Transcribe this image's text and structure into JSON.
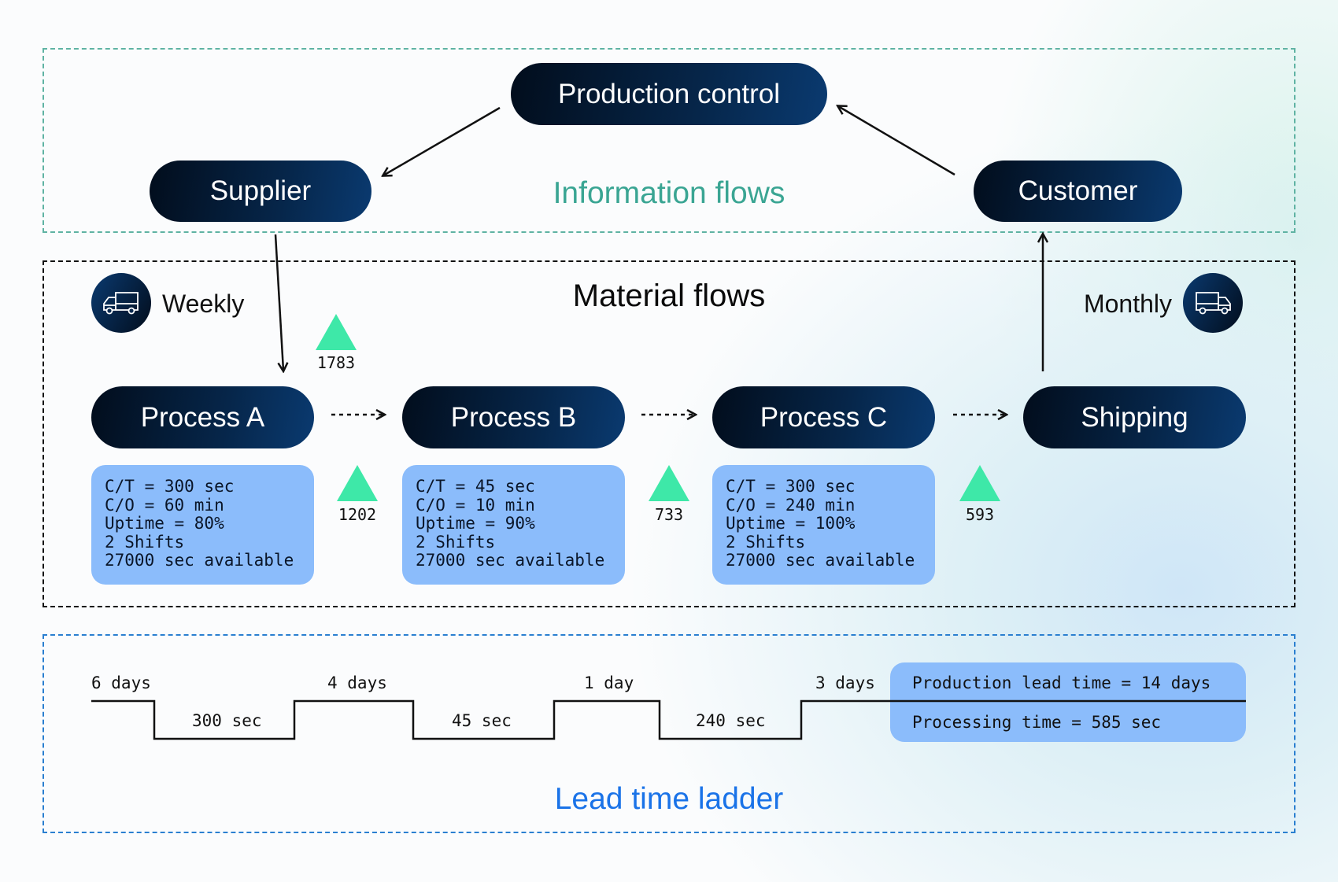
{
  "information_flows": {
    "title": "Information flows",
    "color": "#3aa593"
  },
  "material_flows": {
    "title": "Material flows"
  },
  "lead_time": {
    "title": "Lead time ladder",
    "color": "#1a73e8",
    "top_labels": [
      "6 days",
      "4 days",
      "1 day",
      "3 days"
    ],
    "bottom_labels": [
      "300 sec",
      "45 sec",
      "240 sec"
    ],
    "production_lead_time": "Production lead time = 14 days",
    "processing_time": "Processing time = 585 sec"
  },
  "nodes": {
    "production_control": "Production control",
    "supplier": "Supplier",
    "customer": "Customer"
  },
  "deliveries": {
    "supplier": {
      "label": "Weekly",
      "icon": "truck-icon"
    },
    "customer": {
      "label": "Monthly",
      "icon": "truck-icon"
    }
  },
  "processes": [
    {
      "name": "Process A",
      "details": "C/T = 300 sec\nC/O = 60 min\nUptime = 80%\n2 Shifts\n27000 sec available"
    },
    {
      "name": "Process B",
      "details": "C/T = 45 sec\nC/O = 10 min\nUptime = 90%\n2 Shifts\n27000 sec available"
    },
    {
      "name": "Process C",
      "details": "C/T = 300 sec\nC/O = 240 min\nUptime = 100%\n2 Shifts\n27000 sec available"
    },
    {
      "name": "Shipping"
    }
  ],
  "inventory": [
    "1783",
    "1202",
    "733",
    "593"
  ],
  "colors": {
    "inventory": "#3ee8a8",
    "process_box": "#8bbcfb",
    "pill": "#06264a"
  }
}
